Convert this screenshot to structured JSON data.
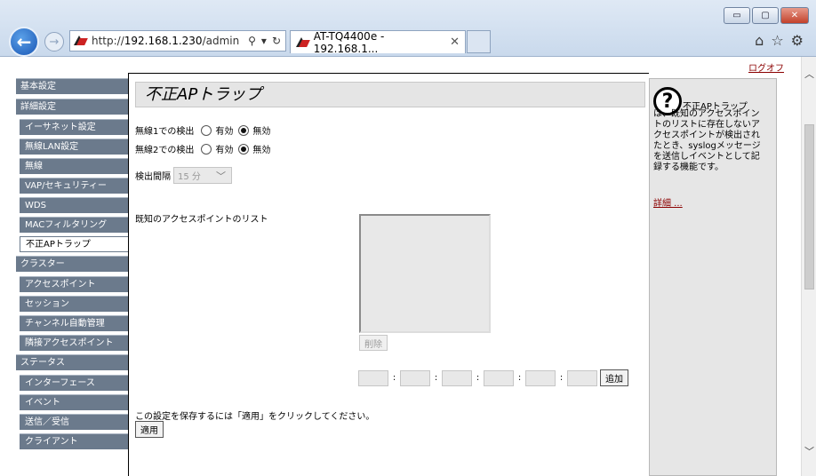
{
  "browser": {
    "url_prefix": "http://",
    "url_host": "192.168.1.230",
    "url_path": "/admin",
    "tab_title": "AT-TQ4400e - 192.168.1...",
    "colors": {
      "back_button": "#1a57b5",
      "chrome": "#dfe9f5"
    }
  },
  "header": {
    "logout": "ログオフ"
  },
  "nav": {
    "groups": [
      {
        "label": "基本設定"
      },
      {
        "label": "詳細設定",
        "items": [
          "イーサネット設定",
          "無線LAN設定",
          "無線",
          "VAP/セキュリティー",
          "WDS",
          "MACフィルタリング",
          "不正APトラップ"
        ]
      },
      {
        "label": "クラスター",
        "items": [
          "アクセスポイント",
          "セッション",
          "チャンネル自動管理",
          "隣接アクセスポイント"
        ]
      },
      {
        "label": "ステータス",
        "items": [
          "インターフェース",
          "イベント",
          "送信／受信",
          "クライアント"
        ]
      }
    ],
    "active": "不正APトラップ",
    "colors": {
      "item_bg": "#6b7a8c"
    }
  },
  "main": {
    "title": "不正APトラップ",
    "radio1": {
      "label": "無線1での検出",
      "on": "有効",
      "off": "無効",
      "selected": "無効"
    },
    "radio2": {
      "label": "無線2での検出",
      "on": "有効",
      "off": "無効",
      "selected": "無効"
    },
    "interval": {
      "label": "検出間隔",
      "value": "15 分"
    },
    "known_ap_list": {
      "label": "既知のアクセスポイントのリスト"
    },
    "delete_button": "削除",
    "mac_separator": ":",
    "add_button": "追加",
    "save_hint": "この設定を保存するには「適用」をクリックしてください。",
    "apply_button": "適用"
  },
  "help": {
    "title": "不正APトラップ",
    "text": "は、既知のアクセスポイントのリストに存在しないアクセスポイントが検出されたとき、syslogメッセージを送信しイベントとして記録する機能です。",
    "more_link": "詳細 ..."
  }
}
